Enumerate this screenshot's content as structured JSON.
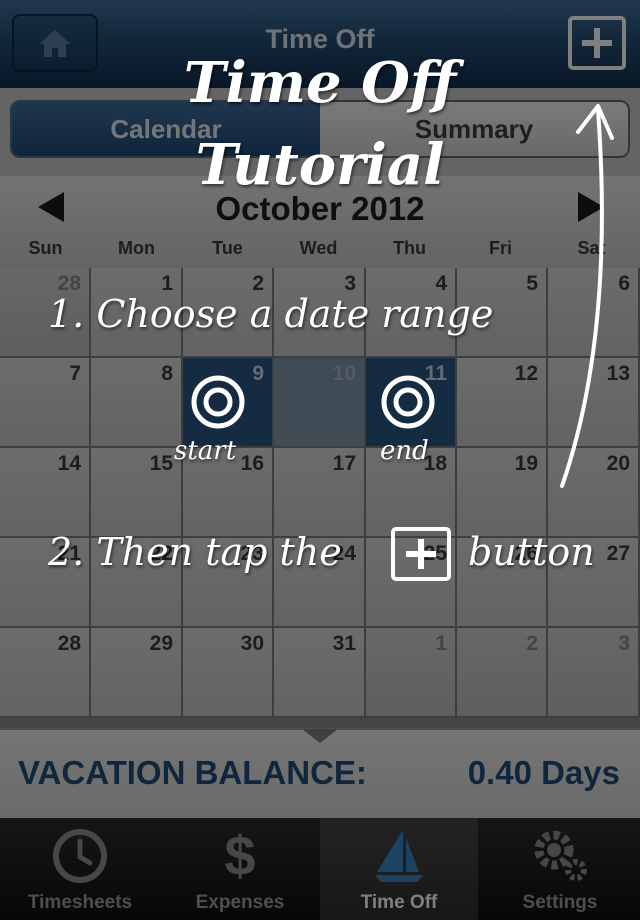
{
  "navbar": {
    "title": "Time Off"
  },
  "segments": {
    "calendar": "Calendar",
    "summary": "Summary",
    "active": "Calendar"
  },
  "calendar": {
    "month_label": "October 2012",
    "weekdays": [
      "Sun",
      "Mon",
      "Tue",
      "Wed",
      "Thu",
      "Fri",
      "Sat"
    ],
    "weeks": [
      [
        "28",
        "1",
        "2",
        "3",
        "4",
        "5",
        "6"
      ],
      [
        "7",
        "8",
        "9",
        "10",
        "11",
        "12",
        "13"
      ],
      [
        "14",
        "15",
        "16",
        "17",
        "18",
        "19",
        "20"
      ],
      [
        "21",
        "22",
        "23",
        "24",
        "25",
        "26",
        "27"
      ],
      [
        "28",
        "29",
        "30",
        "31",
        "1",
        "2",
        "3"
      ]
    ],
    "selected_start": "9",
    "selected_end": "11"
  },
  "balance": {
    "label": "VACATION BALANCE:",
    "value": "0.40 Days"
  },
  "tabbar": {
    "tabs": [
      {
        "label": "Timesheets",
        "icon": "clock-icon"
      },
      {
        "label": "Expenses",
        "icon": "dollar-icon"
      },
      {
        "label": "Time Off",
        "icon": "sailboat-icon"
      },
      {
        "label": "Settings",
        "icon": "gears-icon"
      }
    ],
    "active": "Time Off"
  },
  "tutorial": {
    "title_line1": "Time Off",
    "title_line2": "Tutorial",
    "step1": "1. Choose a date range",
    "step2_before": "2. Then tap the",
    "step2_after": "button",
    "start_label": "start",
    "end_label": "end"
  },
  "colors": {
    "accent_blue": "#1f4d7b",
    "nav_blue": "#21486f",
    "selected_cell": "#2a5782"
  }
}
